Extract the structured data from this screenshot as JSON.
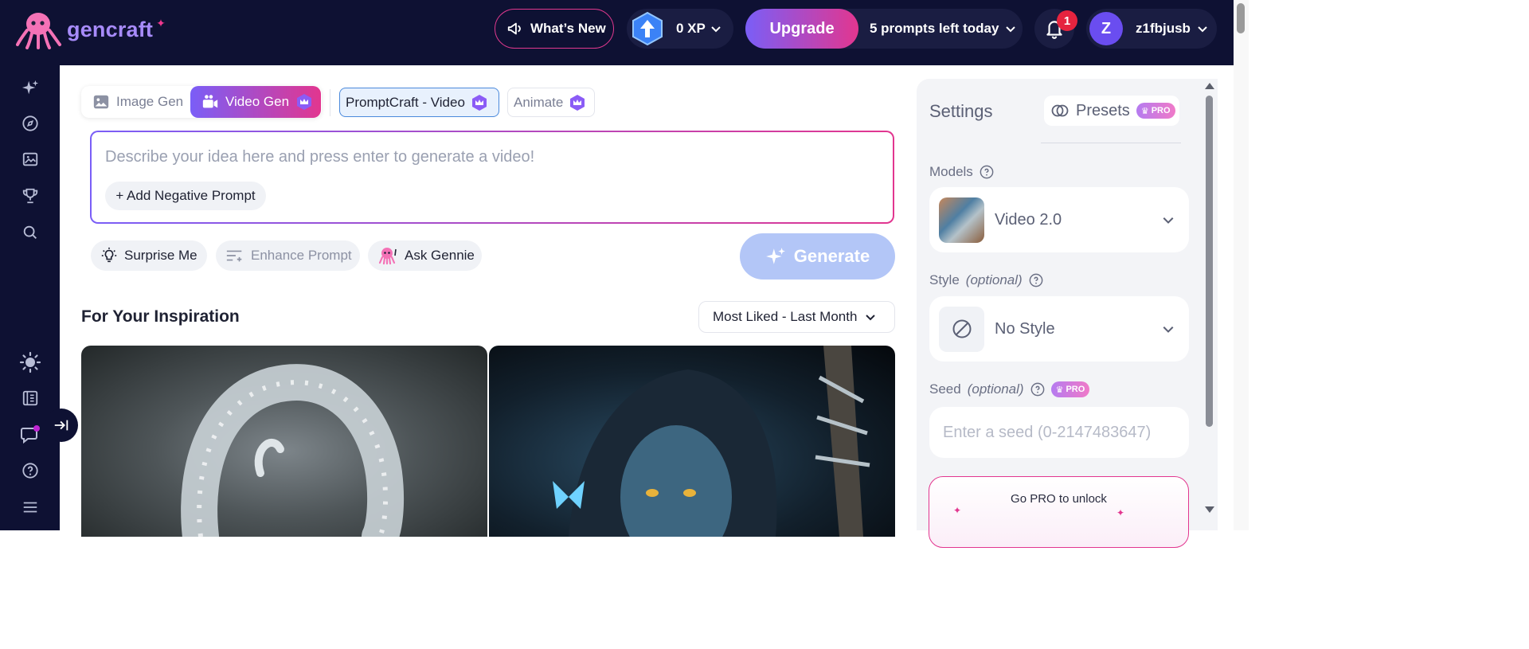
{
  "brand": {
    "name": "gencraft"
  },
  "header": {
    "whats_new_label": "What’s New",
    "xp_label": "0 XP",
    "upgrade_label": "Upgrade",
    "prompts_left_label": "5 prompts left today",
    "notifications_count": "1",
    "user_initial": "Z",
    "username": "z1fbjusb"
  },
  "sidebar": {
    "items": [
      {
        "icon": "sparkles-icon"
      },
      {
        "icon": "compass-icon"
      },
      {
        "icon": "gallery-icon"
      },
      {
        "icon": "trophy-icon"
      },
      {
        "icon": "search-icon"
      },
      {
        "icon": "sun-icon"
      },
      {
        "icon": "journal-icon"
      },
      {
        "icon": "chat-icon"
      },
      {
        "icon": "help-icon"
      },
      {
        "icon": "menu-icon"
      }
    ]
  },
  "mode_tabs": {
    "image_gen": "Image Gen",
    "video_gen": "Video Gen",
    "promptcraft": "PromptCraft - Video",
    "animate": "Animate"
  },
  "prompt": {
    "placeholder": "Describe your idea here and press enter to generate a video!",
    "negative_prompt_label": "+ Add Negative Prompt"
  },
  "actions": {
    "surprise": "Surprise Me",
    "enhance": "Enhance Prompt",
    "gennie": "Ask Gennie",
    "generate": "Generate"
  },
  "inspiration": {
    "title": "For Your Inspiration",
    "sort_value": "Most Liked - Last Month"
  },
  "settings": {
    "title": "Settings",
    "presets_label": "Presets",
    "pro_badge": "PRO",
    "models_label": "Models",
    "model_value": "Video 2.0",
    "style_label": "Style",
    "optional": "(optional)",
    "style_value": "No Style",
    "seed_label": "Seed",
    "seed_placeholder": "Enter a seed (0-2147483647)",
    "gopro_text": "Go PRO to unlock"
  },
  "colors": {
    "nav_bg": "#0e1133",
    "accent_purple": "#7a5ef7",
    "accent_pink": "#e2368f",
    "generate_disabled": "#b3c6f7"
  }
}
